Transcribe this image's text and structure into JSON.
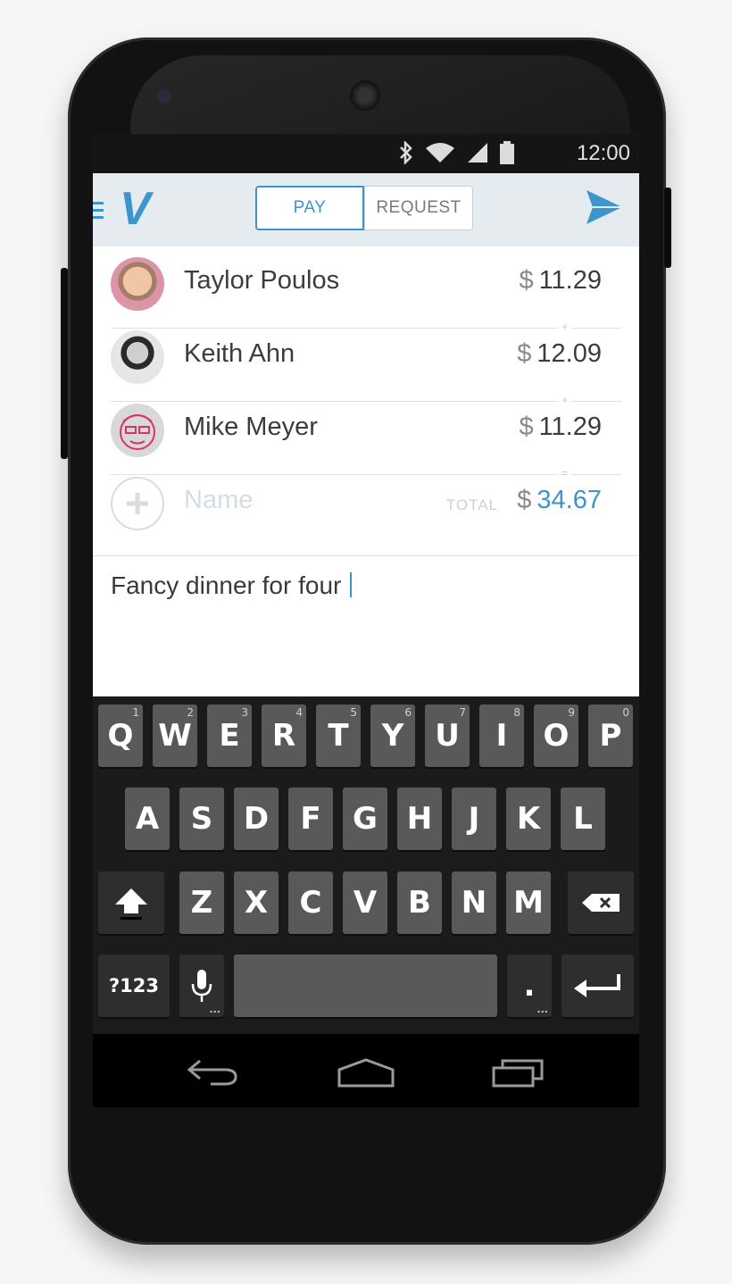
{
  "status_bar": {
    "time": "12:00"
  },
  "header": {
    "logo": "V",
    "tabs": [
      {
        "label": "PAY"
      },
      {
        "label": "REQUEST"
      }
    ],
    "accent_color": "#3d95ce"
  },
  "recipients": [
    {
      "name": "Taylor Poulos",
      "currency": "$",
      "amount": "11.29",
      "separator": "+"
    },
    {
      "name": "Keith Ahn",
      "currency": "$",
      "amount": "12.09",
      "separator": "+"
    },
    {
      "name": "Mike Meyer",
      "currency": "$",
      "amount": "11.29",
      "separator": "="
    }
  ],
  "add_row": {
    "placeholder": "Name",
    "total_label": "TOTAL",
    "currency": "$",
    "total": "34.67"
  },
  "note": {
    "text": "Fancy dinner for four"
  },
  "keyboard": {
    "row1": [
      {
        "key": "Q",
        "hint": "1"
      },
      {
        "key": "W",
        "hint": "2"
      },
      {
        "key": "E",
        "hint": "3"
      },
      {
        "key": "R",
        "hint": "4"
      },
      {
        "key": "T",
        "hint": "5"
      },
      {
        "key": "Y",
        "hint": "6"
      },
      {
        "key": "U",
        "hint": "7"
      },
      {
        "key": "I",
        "hint": "8"
      },
      {
        "key": "O",
        "hint": "9"
      },
      {
        "key": "P",
        "hint": "0"
      }
    ],
    "row2": [
      "A",
      "S",
      "D",
      "F",
      "G",
      "H",
      "J",
      "K",
      "L"
    ],
    "row3": [
      "Z",
      "X",
      "C",
      "V",
      "B",
      "N",
      "M"
    ],
    "symbols_key": "?123",
    "period_key": ".",
    "dots": "..."
  }
}
